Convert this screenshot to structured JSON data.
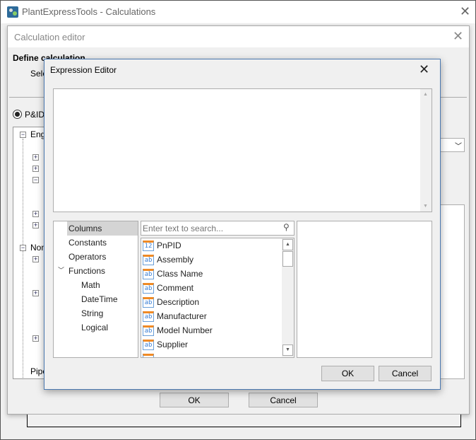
{
  "app": {
    "title": "PlantExpressTools - Calculations",
    "accent": "#2d6b9a"
  },
  "calc_editor": {
    "title": "Calculation editor",
    "heading": "Define calculation",
    "select_label": "Sele",
    "radio_label": "P&ID",
    "tree": [
      "Engi",
      "Non",
      "Pipe"
    ],
    "ok": "OK",
    "cancel": "Cancel"
  },
  "expr": {
    "title": "Expression Editor",
    "search_placeholder": "Enter text to search...",
    "categories": [
      {
        "label": "Columns",
        "selected": true
      },
      {
        "label": "Constants"
      },
      {
        "label": "Operators"
      },
      {
        "label": "Functions",
        "expanded": true
      },
      {
        "label": "Math"
      },
      {
        "label": "DateTime"
      },
      {
        "label": "String"
      },
      {
        "label": "Logical"
      }
    ],
    "columns": [
      {
        "type": "12",
        "label": "PnPID"
      },
      {
        "type": "ab",
        "label": "Assembly"
      },
      {
        "type": "ab",
        "label": "Class Name"
      },
      {
        "type": "ab",
        "label": "Comment"
      },
      {
        "type": "ab",
        "label": "Description"
      },
      {
        "type": "ab",
        "label": "Manufacturer"
      },
      {
        "type": "ab",
        "label": "Model Number"
      },
      {
        "type": "ab",
        "label": "Supplier"
      }
    ],
    "ok": "OK",
    "cancel": "Cancel"
  }
}
